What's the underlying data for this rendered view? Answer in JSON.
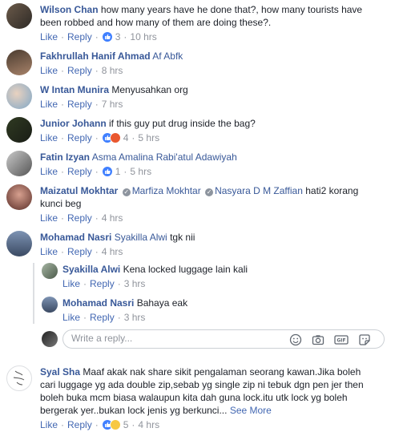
{
  "ui": {
    "like": "Like",
    "reply": "Reply",
    "see_more": "See More"
  },
  "comments": [
    {
      "name": "Wilson Chan",
      "text": "how many years have he done that?, how many tourists have been robbed and how many of them are doing these?.",
      "reactions": 3,
      "time": "10 hrs"
    },
    {
      "name": "Fakhrullah Hanif Ahmad",
      "tag": "Af Abfk",
      "time": "8 hrs"
    },
    {
      "name": "W Intan Munira",
      "text": "Menyusahkan org",
      "time": "7 hrs"
    },
    {
      "name": "Junior Johann",
      "text": "if this guy put drug inside the bag?",
      "reactions": 4,
      "time": "5 hrs"
    },
    {
      "name": "Fatin Izyan",
      "tag": "Asma Amalina Rabi'atul Adawiyah",
      "reactions": 1,
      "time": "5 hrs"
    },
    {
      "name": "Maizatul Mokhtar",
      "tag1": "Marfiza Mokhtar",
      "tag2": "Nasyara D M Zaffian",
      "text1": "hati2 korang",
      "text2": "kunci beg",
      "time": "4 hrs"
    },
    {
      "name": "Mohamad Nasri",
      "tag": "Syakilla Alwi",
      "text": "tgk nii",
      "time": "4 hrs"
    },
    {
      "name": "Syakilla Alwi",
      "text": "Kena locked luggage lain kali",
      "time": "3 hrs"
    },
    {
      "name": "Mohamad Nasri",
      "text": "Bahaya eak",
      "time": "3 hrs"
    },
    {
      "name": "Syal Sha",
      "line1": "Maaf akak nak share sikit pengalaman seorang kawan.Jika boleh",
      "line2": "cari luggage yg ada double zip,sebab yg single zip ni tebuk dgn pen jer then",
      "line3": "boleh buka mcm biasa walaupun kita dah guna lock.itu utk lock yg boleh",
      "line4": "bergerak yer..bukan lock jenis yg berkunci...",
      "reactions": 5,
      "time": "4 hrs"
    }
  ],
  "reply_box": {
    "placeholder": "Write a reply..."
  },
  "colors": {
    "link": "#385898",
    "action": "#4267b2",
    "meta": "#90949c",
    "like_blue": "#4080ff"
  },
  "icons": [
    "like-reaction-icon",
    "haha-reaction-icon",
    "angry-reaction-icon",
    "emoji-icon",
    "camera-icon",
    "gif-icon",
    "sticker-icon",
    "verified-icon"
  ]
}
